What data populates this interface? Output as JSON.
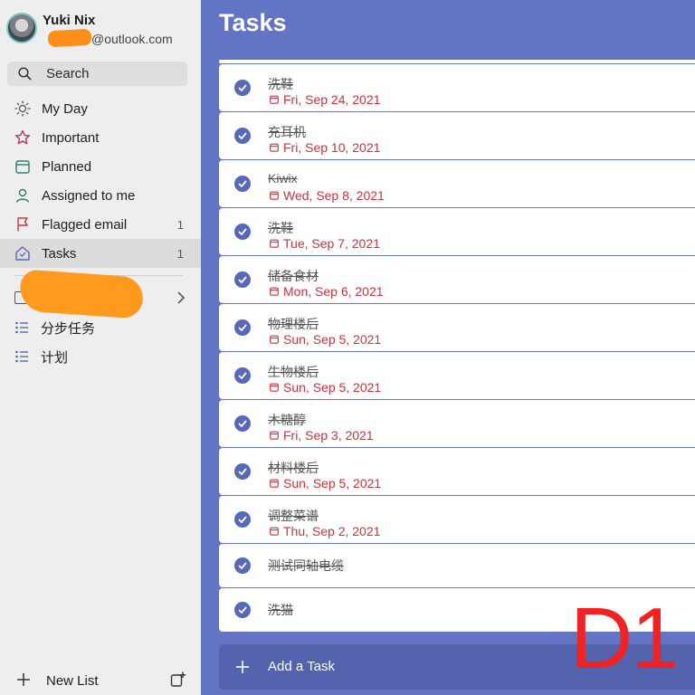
{
  "profile": {
    "name": "Yuki Nix",
    "email_suffix": "@outlook.com"
  },
  "search": {
    "label": "Search"
  },
  "nav": [
    {
      "label": "My Day",
      "count": "",
      "icon": "sun-icon",
      "color": "#555555"
    },
    {
      "label": "Important",
      "count": "",
      "icon": "star-icon",
      "color": "#b8355b"
    },
    {
      "label": "Planned",
      "count": "",
      "icon": "calendar-icon",
      "color": "#2e7d6b"
    },
    {
      "label": "Assigned to me",
      "count": "",
      "icon": "person-icon",
      "color": "#2e7d5b"
    },
    {
      "label": "Flagged email",
      "count": "1",
      "icon": "flag-icon",
      "color": "#c23b3b"
    },
    {
      "label": "Tasks",
      "count": "1",
      "icon": "home-icon",
      "color": "#5566b5"
    }
  ],
  "lists": [
    {
      "label": "分步任务"
    },
    {
      "label": "计划"
    }
  ],
  "sidebar_footer": {
    "new_list_label": "New List"
  },
  "main": {
    "title": "Tasks",
    "tasks": [
      {
        "title": "洗鞋",
        "date": "Fri, Sep 24, 2021"
      },
      {
        "title": "充耳机",
        "date": "Fri, Sep 10, 2021"
      },
      {
        "title": "Kiwix",
        "date": "Wed, Sep 8, 2021"
      },
      {
        "title": "洗鞋",
        "date": "Tue, Sep 7, 2021"
      },
      {
        "title": "储备食材",
        "date": "Mon, Sep 6, 2021"
      },
      {
        "title": "物理楼后",
        "date": "Sun, Sep 5, 2021"
      },
      {
        "title": "生物楼后",
        "date": "Sun, Sep 5, 2021"
      },
      {
        "title": "木糖醇",
        "date": "Fri, Sep 3, 2021"
      },
      {
        "title": "材料楼后",
        "date": "Sun, Sep 5, 2021"
      },
      {
        "title": "调整菜谱",
        "date": "Thu, Sep 2, 2021"
      },
      {
        "title": "测试同轴电缆",
        "date": ""
      },
      {
        "title": "洗猫",
        "date": ""
      }
    ],
    "add_task_label": "Add a Task"
  },
  "overlay": {
    "watermark": "D1"
  },
  "colors": {
    "accent": "#6374c4",
    "due_date": "#d0313a",
    "check": "#5768b8"
  }
}
